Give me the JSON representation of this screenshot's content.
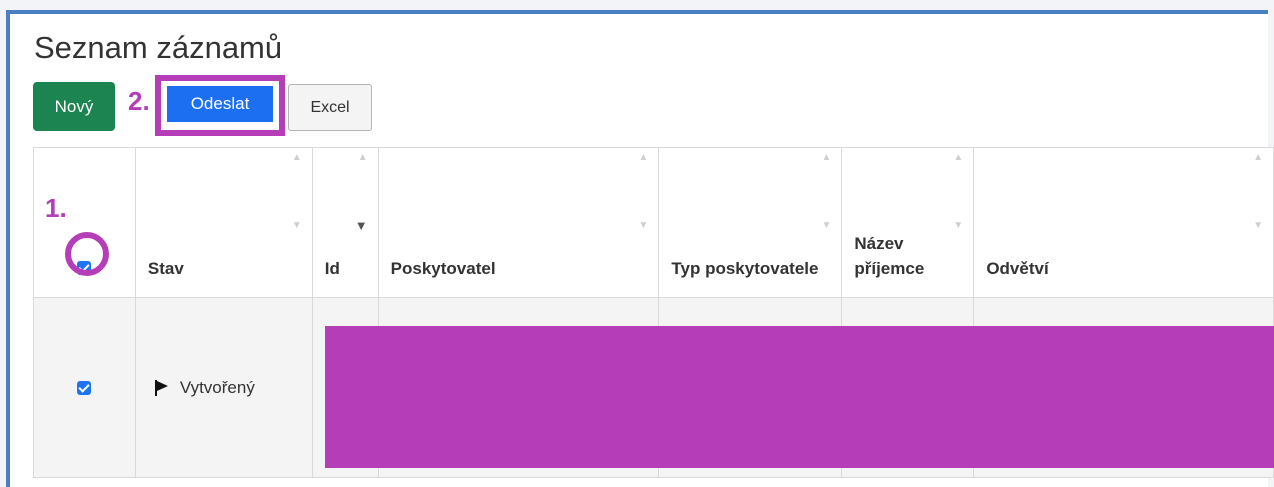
{
  "page": {
    "title": "Seznam záznamů"
  },
  "toolbar": {
    "novy_label": "Nový",
    "odeslat_label": "Odeslat",
    "excel_label": "Excel"
  },
  "annotations": {
    "step1": "1.",
    "step2": "2.",
    "highlight_color": "#b53db8"
  },
  "table": {
    "columns": [
      "",
      "Stav",
      "Id",
      "Poskytovatel",
      "Typ poskytovatele",
      "Název příjemce",
      "Odvětví"
    ],
    "rows": [
      {
        "checked": true,
        "stav": "Vytvořený"
      }
    ],
    "header_checked": true,
    "sorted_column": "Id"
  },
  "colors": {
    "novy_bg": "#1c8450",
    "odeslat_bg": "#1d6ff2",
    "frame_border": "#4a7fc1"
  }
}
